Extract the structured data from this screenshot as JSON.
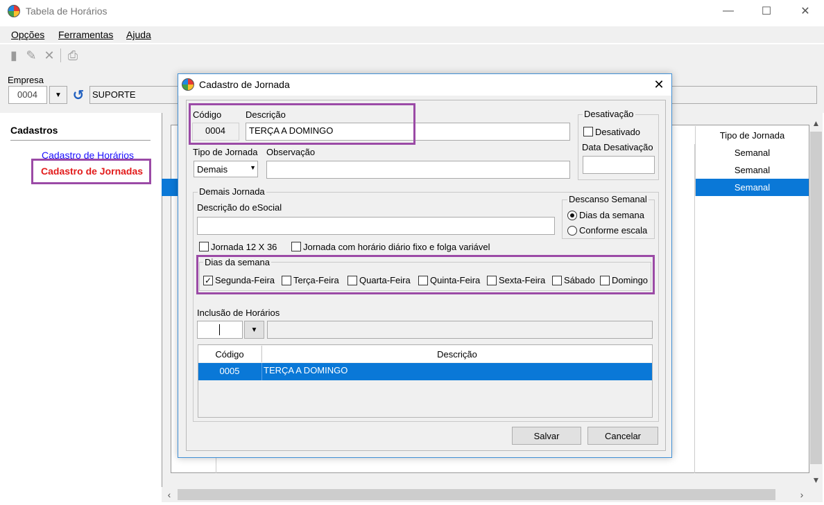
{
  "window": {
    "title": "Tabela de Horários",
    "controls": {
      "minimize": "—",
      "maximize": "☐",
      "close": "✕"
    }
  },
  "menu": {
    "opcoes": "Opções",
    "ferramentas": "Ferramentas",
    "ajuda": "Ajuda"
  },
  "toolbar": [
    "new-doc-icon",
    "edit-pencil-icon",
    "delete-x-icon",
    "print-icon"
  ],
  "empresa": {
    "label": "Empresa",
    "code": "0004",
    "name": "SUPORTE"
  },
  "left_panel": {
    "title": "Cadastros",
    "links": [
      "Cadastro de Horários",
      "Cadastro de Jornadas"
    ]
  },
  "background_grid": {
    "column_header": "Tipo de Jornada",
    "rows": [
      "Semanal",
      "Semanal",
      "Semanal"
    ]
  },
  "dialog": {
    "title": "Cadastro de Jornada",
    "codigo_label": "Código",
    "codigo_value": "0004",
    "descricao_label": "Descrição",
    "descricao_value": "TERÇA A DOMINGO",
    "tipo_jornada_label": "Tipo de Jornada",
    "tipo_jornada_value": "Demais",
    "observacao_label": "Observação",
    "desativacao": {
      "title": "Desativação",
      "desativado_label": "Desativado",
      "desativado_checked": false,
      "data_label": "Data Desativação"
    },
    "demais_jornada": {
      "title": "Demais Jornada",
      "descricao_esocial_label": "Descrição do eSocial",
      "descanso_semanal": {
        "title": "Descanso Semanal",
        "options": [
          "Dias da semana",
          "Conforme escala"
        ],
        "selected": "Dias da semana"
      },
      "jornada_12x36": "Jornada 12 X 36",
      "jornada_fixo": "Jornada com horário diário fixo e folga variável",
      "dias_semana": {
        "title": "Dias da semana",
        "days": [
          {
            "label": "Segunda-Feira",
            "checked": true
          },
          {
            "label": "Terça-Feira",
            "checked": false
          },
          {
            "label": "Quarta-Feira",
            "checked": false
          },
          {
            "label": "Quinta-Feira",
            "checked": false
          },
          {
            "label": "Sexta-Feira",
            "checked": false
          },
          {
            "label": "Sábado",
            "checked": false
          },
          {
            "label": "Domingo",
            "checked": false
          }
        ]
      },
      "inclusao_label": "Inclusão de Horários",
      "grid": {
        "headers": [
          "Código",
          "Descrição"
        ],
        "rows": [
          {
            "codigo": "0005",
            "descricao": "TERÇA A DOMINGO"
          }
        ]
      }
    },
    "buttons": {
      "salvar": "Salvar",
      "cancelar": "Cancelar"
    }
  },
  "colors": {
    "highlight": "#9b4aa6",
    "selection": "#0a78d7",
    "link": "#1a0dff",
    "active_link": "#e21b1b"
  }
}
